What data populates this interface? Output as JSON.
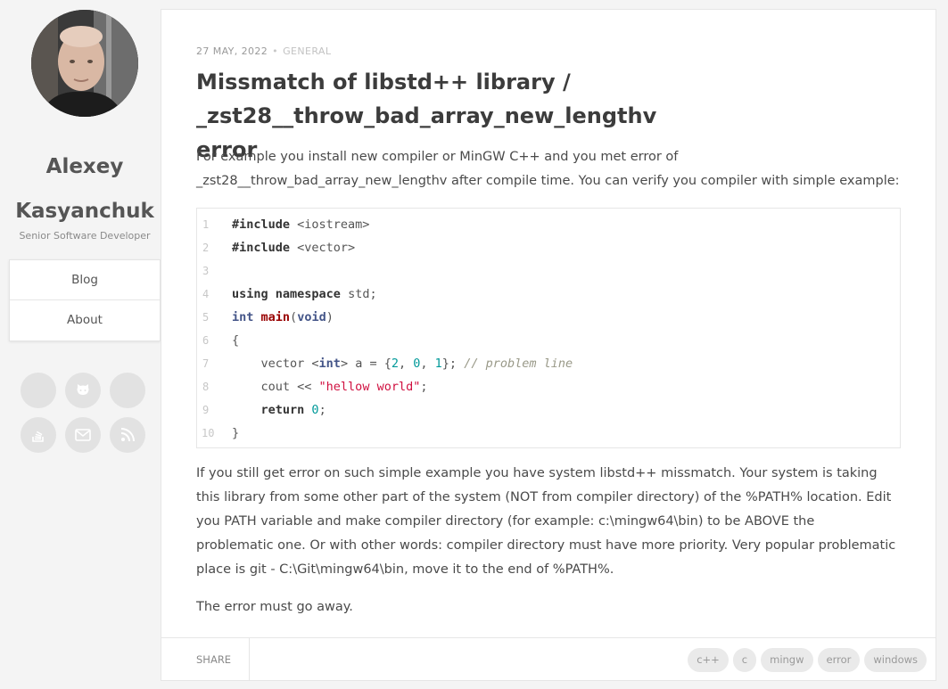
{
  "sidebar": {
    "author_first": "Alexey",
    "author_last": "Kasyanchuk",
    "role": "Senior Software Developer",
    "nav": [
      {
        "label": "Blog"
      },
      {
        "label": "About"
      }
    ],
    "social_icons": [
      "linkedin-icon",
      "github-icon",
      "twitter-icon",
      "stackoverflow-icon",
      "email-icon",
      "rss-icon"
    ]
  },
  "post": {
    "date": "27 MAY, 2022",
    "separator": "•",
    "category": "GENERAL",
    "title_line1": "Missmatch of libstd++ library / _zst28__throw_bad_array_new_lengthv",
    "title_line2": "error",
    "intro_line1": "For example you install new compiler or MinGW C++ and you met error of",
    "intro_line2": "_zst28__throw_bad_array_new_lengthv after compile time. You can verify you compiler with simple example:",
    "code": {
      "line_numbers": [
        "1",
        "2",
        "3",
        "4",
        "5",
        "6",
        "7",
        "8",
        "9",
        "10"
      ],
      "l1_kw": "#include",
      "l1_rest": " <iostream>",
      "l2_kw": "#include",
      "l2_rest": " <vector>",
      "l4_kw1": "using",
      "l4_kw2": "namespace",
      "l4_rest": " std;",
      "l5_type": "int",
      "l5_fn": "main",
      "l5_open": "(",
      "l5_void": "void",
      "l5_close": ")",
      "l6": "{",
      "l7_a": "    vector <",
      "l7_int": "int",
      "l7_b": "> a = {",
      "l7_n1": "2",
      "l7_c1": ", ",
      "l7_n2": "0",
      "l7_c2": ", ",
      "l7_n3": "1",
      "l7_c": "}; ",
      "l7_comment": "// problem line",
      "l8_a": "    cout << ",
      "l8_str": "\"hellow world\"",
      "l8_b": ";",
      "l9_kw": "    return",
      "l9_sp": " ",
      "l9_num": "0",
      "l9_b": ";",
      "l10": "}"
    },
    "body_lines": [
      "If you still get error on such simple example you have system libstd++ missmatch. Your system is taking",
      "this library from some other part of the system (NOT from compiler directory) of the %PATH% location. Edit",
      "you PATH variable and make compiler directory (for example: c:\\mingw64\\bin) to be ABOVE the",
      "problematic one. Or with other words: compiler directory must have more priority. Very popular problematic",
      "place is git - C:\\Git\\mingw64\\bin, move it to the end of %PATH%."
    ],
    "closing": "The error must go away.",
    "share_label": "SHARE",
    "tags": [
      "c++",
      "c",
      "mingw",
      "error",
      "windows"
    ]
  }
}
